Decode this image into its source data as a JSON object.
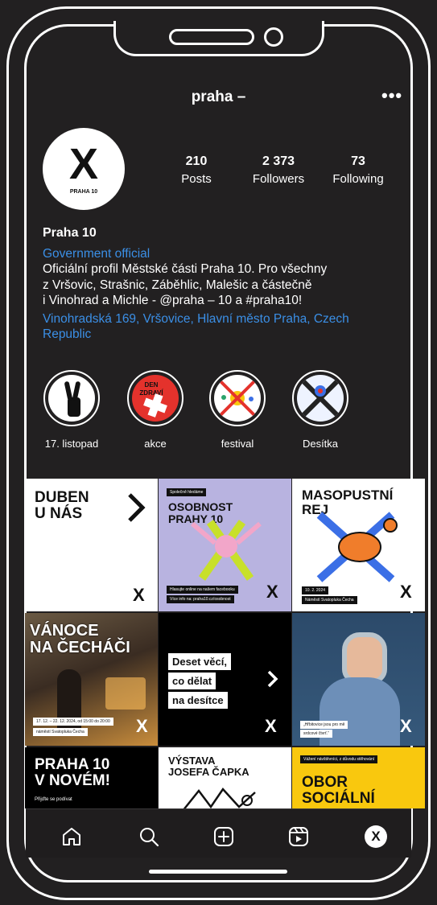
{
  "profile": {
    "username": "praha –",
    "avatar_mark": "X",
    "avatar_sub": "PRAHA 10",
    "stats": [
      {
        "value": "210",
        "label": "Posts"
      },
      {
        "value": "2 373",
        "label": "Followers"
      },
      {
        "value": "73",
        "label": "Following"
      }
    ],
    "name": "Praha 10",
    "category": "Government official",
    "bio_lines": [
      "Oficiální profil Městské části Praha 10. Pro všechny",
      "z Vršovic, Strašnic, Záběhlic, Malešic a částečně",
      "i Vinohrad a Michle - @praha – 10 a #praha10!"
    ],
    "address": "Vinohradská 169, Vršovice, Hlavní město Praha, Czech Republic"
  },
  "highlights": [
    {
      "label": "17. listopad"
    },
    {
      "label": "akce",
      "image_text": "DEN ZDRAVÍ"
    },
    {
      "label": "festival"
    },
    {
      "label": "Desítka"
    }
  ],
  "posts": {
    "p1": {
      "title_1": "DUBEN",
      "title_2": "U NÁS",
      "mark": "X"
    },
    "p2": {
      "tag": "Společně hledáme",
      "title_1": "OSOBNOST",
      "title_2": "PRAHY 10",
      "caption_1": "Hlasujte online na našem facebooku",
      "caption_2": "Více info na: praha10.cz/osobnost",
      "mark": "X"
    },
    "p3": {
      "title_1": "MASOPUSTNÍ",
      "title_2": "REJ",
      "date": "10. 2. 2024",
      "place": "Náměstí Svatopluka Čecha",
      "mark": "X"
    },
    "p4": {
      "title_1": "VÁNOCE",
      "title_2": "NA ČECHÁČI",
      "date": "17. 12. – 22. 12. 2024, od 15:00 do 20:00",
      "place": "náměstí Svatopluka Čecha",
      "mark": "X"
    },
    "p5": {
      "line_1": "Deset věcí,",
      "line_2": "co dělat",
      "line_3": "na desítce",
      "mark": "X"
    },
    "p6": {
      "quote_1": "„Hřbitovice jsou pro mě",
      "quote_2": "srdcové čtvrť.“",
      "mark": "X"
    },
    "p7": {
      "title_1": "PRAHA 10",
      "title_2": "V NOVÉM!",
      "sub": "Přijďte se podívat"
    },
    "p8": {
      "title_1": "VÝSTAVA",
      "title_2": "JOSEFA ČAPKA"
    },
    "p9": {
      "tag": "Vážení návštěvníci, z důvodu stěhování",
      "title_1": "OBOR",
      "title_2": "SOCIÁLNÍ"
    }
  },
  "colors": {
    "background": "#222021",
    "link": "#3b8fe6",
    "lavender": "#b8b3e0",
    "yellow": "#f9c80e",
    "pink": "#f2a6c9"
  },
  "nav_icons": [
    "home-icon",
    "search-icon",
    "create-icon",
    "reels-icon",
    "profile-icon"
  ],
  "nav_profile_mark": "X"
}
